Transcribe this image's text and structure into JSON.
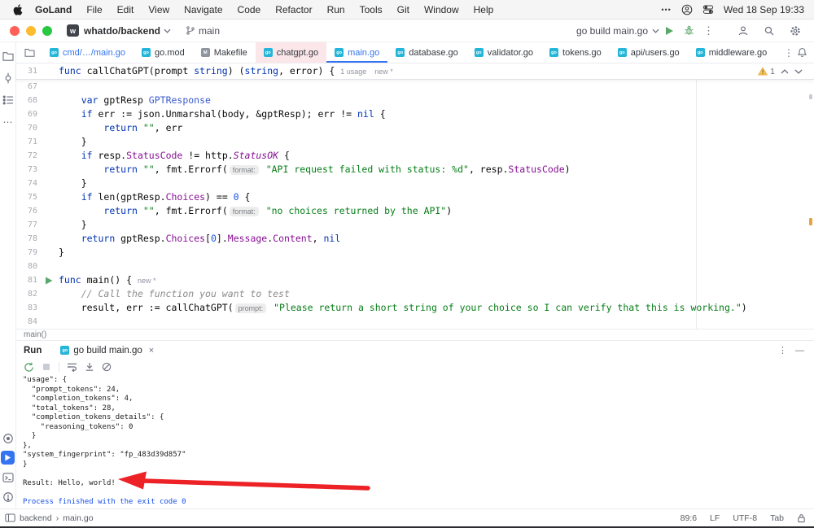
{
  "menubar": {
    "items": [
      "GoLand",
      "File",
      "Edit",
      "View",
      "Navigate",
      "Code",
      "Refactor",
      "Run",
      "Tools",
      "Git",
      "Window",
      "Help"
    ],
    "clock": "Wed 18 Sep 19:33"
  },
  "titlebar": {
    "project": "whatdo/backend",
    "project_initial": "w",
    "branch": "main",
    "run_config": "go build main.go"
  },
  "tabbar": {
    "tabs": [
      {
        "label": "cmd/…/main.go",
        "icon": "go",
        "state": "modified"
      },
      {
        "label": "go.mod",
        "icon": "go"
      },
      {
        "label": "Makefile",
        "icon": "make"
      },
      {
        "label": "chatgpt.go",
        "icon": "go",
        "state": "pink"
      },
      {
        "label": "main.go",
        "icon": "go",
        "state": "active modified"
      },
      {
        "label": "database.go",
        "icon": "go"
      },
      {
        "label": "validator.go",
        "icon": "go"
      },
      {
        "label": "tokens.go",
        "icon": "go"
      },
      {
        "label": "api/users.go",
        "icon": "go"
      },
      {
        "label": "middleware.go",
        "icon": "go"
      }
    ]
  },
  "sticky": {
    "no": "31",
    "tk": [
      [
        "k",
        "func"
      ],
      [
        "p",
        " callChatGPT(prompt "
      ],
      [
        "k",
        "string"
      ],
      [
        "p",
        ") ("
      ],
      [
        "k",
        "string"
      ],
      [
        "p",
        ", error) { "
      ],
      [
        "v",
        "1 usage    new *"
      ]
    ],
    "warning_count": "1"
  },
  "editor": {
    "breadcrumb": "main()",
    "lines": [
      {
        "no": "67",
        "tk": []
      },
      {
        "no": "68",
        "tk": [
          [
            "p",
            "    "
          ],
          [
            "k",
            "var"
          ],
          [
            "p",
            " gptResp "
          ],
          [
            "t",
            "GPTResponse"
          ]
        ]
      },
      {
        "no": "69",
        "tk": [
          [
            "p",
            "    "
          ],
          [
            "k",
            "if"
          ],
          [
            "p",
            " err := json.Unmarshal(body, &gptResp); err != "
          ],
          [
            "k",
            "nil"
          ],
          [
            "p",
            " {"
          ]
        ]
      },
      {
        "no": "70",
        "tk": [
          [
            "p",
            "        "
          ],
          [
            "k",
            "return"
          ],
          [
            "p",
            " "
          ],
          [
            "s",
            "\"\""
          ],
          [
            "p",
            ", err"
          ]
        ]
      },
      {
        "no": "71",
        "tk": [
          [
            "p",
            "    }"
          ]
        ]
      },
      {
        "no": "72",
        "tk": [
          [
            "p",
            "    "
          ],
          [
            "k",
            "if"
          ],
          [
            "p",
            " resp."
          ],
          [
            "f",
            "StatusCode"
          ],
          [
            "p",
            " != http."
          ],
          [
            "fc",
            "StatusOK"
          ],
          [
            "p",
            " {"
          ]
        ]
      },
      {
        "no": "73",
        "tk": [
          [
            "p",
            "        "
          ],
          [
            "k",
            "return"
          ],
          [
            "p",
            " "
          ],
          [
            "s",
            "\"\""
          ],
          [
            "p",
            ", fmt.Errorf("
          ],
          [
            "h",
            "format:"
          ],
          [
            "p",
            " "
          ],
          [
            "s",
            "\"API request failed with status: %d\""
          ],
          [
            "p",
            ", resp."
          ],
          [
            "f",
            "StatusCode"
          ],
          [
            "p",
            ")"
          ]
        ]
      },
      {
        "no": "74",
        "tk": [
          [
            "p",
            "    }"
          ]
        ]
      },
      {
        "no": "75",
        "tk": [
          [
            "p",
            "    "
          ],
          [
            "k",
            "if"
          ],
          [
            "p",
            " len(gptResp."
          ],
          [
            "f",
            "Choices"
          ],
          [
            "p",
            ") == "
          ],
          [
            "n",
            "0"
          ],
          [
            "p",
            " {"
          ]
        ]
      },
      {
        "no": "76",
        "tk": [
          [
            "p",
            "        "
          ],
          [
            "k",
            "return"
          ],
          [
            "p",
            " "
          ],
          [
            "s",
            "\"\""
          ],
          [
            "p",
            ", fmt.Errorf("
          ],
          [
            "h",
            "format:"
          ],
          [
            "p",
            " "
          ],
          [
            "s",
            "\"no choices returned by the API\""
          ],
          [
            "p",
            ")"
          ]
        ]
      },
      {
        "no": "77",
        "tk": [
          [
            "p",
            "    }"
          ]
        ]
      },
      {
        "no": "78",
        "tk": [
          [
            "p",
            "    "
          ],
          [
            "k",
            "return"
          ],
          [
            "p",
            " gptResp."
          ],
          [
            "f",
            "Choices"
          ],
          [
            "p",
            "["
          ],
          [
            "n",
            "0"
          ],
          [
            "p",
            "]."
          ],
          [
            "f",
            "Message"
          ],
          [
            "p",
            "."
          ],
          [
            "f",
            "Content"
          ],
          [
            "p",
            ", "
          ],
          [
            "k",
            "nil"
          ]
        ]
      },
      {
        "no": "79",
        "tk": [
          [
            "p",
            "}"
          ]
        ]
      },
      {
        "no": "80",
        "tk": []
      },
      {
        "no": "81",
        "run": true,
        "tk": [
          [
            "k",
            "func"
          ],
          [
            "p",
            " main() { "
          ],
          [
            "v",
            "new *"
          ]
        ]
      },
      {
        "no": "82",
        "tk": [
          [
            "p",
            "    "
          ],
          [
            "c",
            "// Call the function you want to test"
          ]
        ]
      },
      {
        "no": "83",
        "tk": [
          [
            "p",
            "    result, err := callChatGPT("
          ],
          [
            "h",
            "prompt:"
          ],
          [
            "p",
            " "
          ],
          [
            "s",
            "\"Please return a short string of your choice so I can verify that this is working.\""
          ],
          [
            "p",
            ")"
          ]
        ]
      },
      {
        "no": "84",
        "tk": []
      }
    ]
  },
  "run_panel": {
    "title": "Run",
    "tab": "go build main.go",
    "console": [
      {
        "t": "\"usage\": {"
      },
      {
        "t": "  \"prompt_tokens\": 24,"
      },
      {
        "t": "  \"completion_tokens\": 4,"
      },
      {
        "t": "  \"total_tokens\": 28,"
      },
      {
        "t": "  \"completion_tokens_details\": {"
      },
      {
        "t": "    \"reasoning_tokens\": 0"
      },
      {
        "t": "  }"
      },
      {
        "t": "},"
      },
      {
        "t": "\"system_fingerprint\": \"fp_483d39d857\""
      },
      {
        "t": "}"
      },
      {
        "t": ""
      },
      {
        "t": "Result: Hello, world!"
      },
      {
        "t": ""
      },
      {
        "t": "Process finished with the exit code 0",
        "b": true
      }
    ]
  },
  "statusbar": {
    "project": "backend",
    "file": "main.go",
    "right": [
      "89:6",
      "LF",
      "UTF-8",
      "Tab"
    ]
  },
  "icons": {
    "triple_dot": "•••",
    "more_v": "⋮",
    "more_h": "⋯",
    "close": "×",
    "minimize": "—",
    "chevron_right": "›"
  },
  "colors": {
    "accent": "#3574F0",
    "keyword": "#0033B3",
    "string": "#067D17",
    "number": "#1750EB",
    "member": "#871094",
    "type": "#3B5BCD",
    "comment": "#8C8C8C",
    "run_green": "#59A869",
    "warning": "#E8A33D",
    "arrow_red": "#EC2227"
  }
}
